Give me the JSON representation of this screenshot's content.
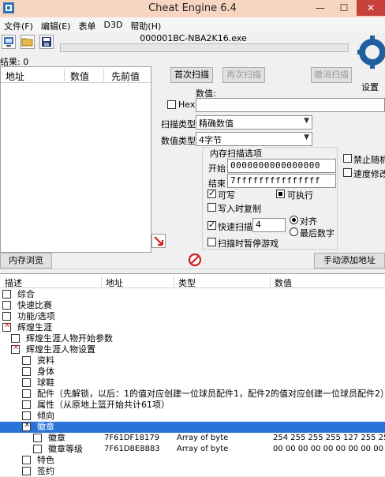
{
  "window": {
    "title": "Cheat Engine 6.4",
    "minimize": "—",
    "maximize": "☐",
    "close": "✕"
  },
  "menu": [
    "文件(F)",
    "编辑(E)",
    "表单",
    "D3D",
    "帮助(H)"
  ],
  "process": "000001BC-NBA2K16.exe",
  "results": "结果: 0",
  "settings_label": "设置",
  "found_list": {
    "headers": [
      "地址",
      "数值",
      "先前值"
    ]
  },
  "scan": {
    "first_scan": "首次扫描",
    "next_scan": "再次扫描",
    "undo_scan": "撤消扫描",
    "value_label": "数值:",
    "hex_label": "Hex",
    "scan_type_label": "扫描类型",
    "scan_type_value": "精确数值",
    "value_type_label": "数值类型",
    "value_type_value": "4字节"
  },
  "memory_options": {
    "title": "内存扫描选项",
    "start_label": "开始",
    "start_value": "0000000000000000",
    "end_label": "结束",
    "end_value": "7fffffffffffffff",
    "writable": "可写",
    "executable": "可执行",
    "copy_on_write": "写入时复制",
    "fast_scan": "快速扫描",
    "fast_scan_value": "4",
    "alignment": "对齐",
    "last_digits": "最后数字",
    "pause_game": "扫描时暂停游戏"
  },
  "right_options": {
    "unrandomizer": "禁止随机",
    "speedhack": "速度修改"
  },
  "buttons": {
    "memory_view": "内存浏览",
    "add_address": "手动添加地址"
  },
  "table": {
    "headers": [
      "描述",
      "地址",
      "类型",
      "数值"
    ],
    "rows": [
      {
        "desc": "综合",
        "addr": "",
        "type": "",
        "value": ""
      },
      {
        "desc": "快速比赛",
        "addr": "",
        "type": "",
        "value": ""
      },
      {
        "desc": "功能/选项",
        "addr": "",
        "type": "",
        "value": ""
      },
      {
        "desc": "辉煌生涯",
        "addr": "",
        "type": "",
        "value": ""
      },
      {
        "desc": "辉煌生涯人物开始参数",
        "addr": "",
        "type": "",
        "value": ""
      },
      {
        "desc": "辉煌生涯人物设置",
        "addr": "",
        "type": "",
        "value": ""
      },
      {
        "desc": "资料",
        "addr": "",
        "type": "",
        "value": ""
      },
      {
        "desc": "身体",
        "addr": "",
        "type": "",
        "value": ""
      },
      {
        "desc": "球鞋",
        "addr": "",
        "type": "",
        "value": ""
      },
      {
        "desc": "配件（先解锁，以后：1的值对应创建一位球员配件1，配件2的值对应创建一位球员配件2）",
        "addr": "",
        "type": "",
        "value": ""
      },
      {
        "desc": "属性（从原地上篮开始共计61项）",
        "addr": "",
        "type": "",
        "value": ""
      },
      {
        "desc": "倾向",
        "addr": "",
        "type": "",
        "value": ""
      },
      {
        "desc": "徽章",
        "addr": "",
        "type": "",
        "value": ""
      },
      {
        "desc": "徽章",
        "addr": "7F61DF18179",
        "type": "Array of byte",
        "value": "254 255 255 255 127 255 255 2"
      },
      {
        "desc": "徽章等级",
        "addr": "7F61D8E8883",
        "type": "Array of byte",
        "value": "00 00 00 00 00 00 00 00 00 00"
      },
      {
        "desc": "特色",
        "addr": "",
        "type": "",
        "value": ""
      },
      {
        "desc": "签约",
        "addr": "",
        "type": "",
        "value": ""
      }
    ]
  }
}
